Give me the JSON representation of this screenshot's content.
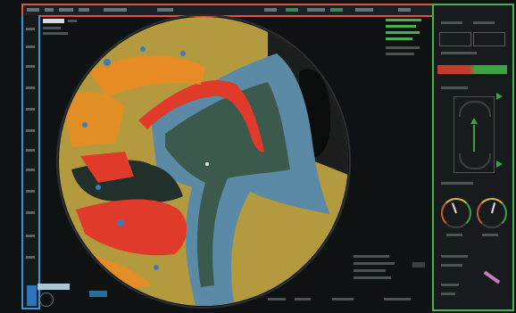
{
  "colors": {
    "frame_top": "#e0523a",
    "frame_left": "#3b93d6",
    "frame_right": "#45b549",
    "sea_clutter": "#b39a3e",
    "return_strong": "#e03a2a",
    "return_mid": "#f08a20",
    "return_weak": "#3d7ab8",
    "land_shallow": "#5b8aa6",
    "land_mid": "#3c5a4c",
    "land_dark": "#1f2a28",
    "level_low": "#c93a2e",
    "level_high": "#3ea043"
  },
  "icons": {
    "radar_display": "radar-ppi-icon",
    "heading_arrow": "triangle-arrow-icon",
    "rudder_gauge": "gauge-icon",
    "range_knob": "knob-icon"
  },
  "levels": {
    "signal_level_fraction": 0.5
  }
}
